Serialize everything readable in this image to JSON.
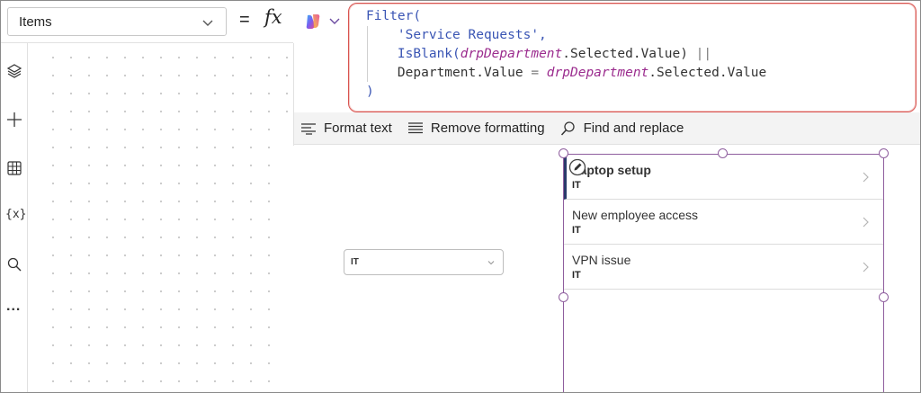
{
  "property_selector": {
    "value": "Items"
  },
  "formula_bar": {
    "equals": "=",
    "fx": "fx",
    "lines": [
      {
        "parts": [
          {
            "t": "Filter(",
            "c": "fn"
          }
        ]
      },
      {
        "parts": [
          {
            "t": "    'Service Requests',",
            "c": "str"
          }
        ]
      },
      {
        "parts": [
          {
            "t": "    IsBlank(",
            "c": "fn"
          },
          {
            "t": "drpDepartment",
            "c": "ctl"
          },
          {
            "t": ".Selected.Value) ",
            "c": ""
          },
          {
            "t": "||",
            "c": "op"
          }
        ]
      },
      {
        "parts": [
          {
            "t": "    Department.Value ",
            "c": ""
          },
          {
            "t": "=",
            "c": "op"
          },
          {
            "t": " ",
            "c": ""
          },
          {
            "t": "drpDepartment",
            "c": "ctl"
          },
          {
            "t": ".Selected.Value",
            "c": ""
          }
        ]
      },
      {
        "parts": [
          {
            "t": ")",
            "c": "fn"
          }
        ]
      }
    ]
  },
  "toolbar": {
    "format_text": "Format text",
    "remove_formatting": "Remove formatting",
    "find_replace": "Find and replace"
  },
  "rail_icons": [
    "layers-icon",
    "plus-icon",
    "table-icon",
    "variables-icon",
    "search-icon",
    "more-icon"
  ],
  "rail_labels": {
    "variables": "{x}",
    "more": "..."
  },
  "dropdown": {
    "value": "IT"
  },
  "gallery": {
    "items": [
      {
        "title": "Laptop setup",
        "department": "IT",
        "selected": true
      },
      {
        "title": "New employee access",
        "department": "IT",
        "selected": false
      },
      {
        "title": "VPN issue",
        "department": "IT",
        "selected": false
      }
    ]
  },
  "colors": {
    "formula_border": "#d9534f",
    "selection": "#8f5e9e",
    "selected_bar": "#2a3a6b"
  }
}
